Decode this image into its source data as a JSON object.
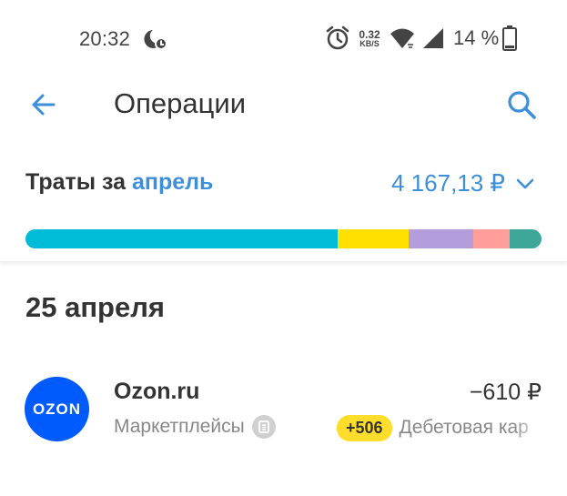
{
  "status_bar": {
    "time": "20:32",
    "net_speed_value": "0.32",
    "net_speed_unit": "KB/S",
    "battery_text": "14 %",
    "icons": [
      "moon-icon",
      "alarm-icon",
      "wifi-icon",
      "signal-icon",
      "battery-icon"
    ]
  },
  "app_bar": {
    "title": "Операции",
    "icons": [
      "back-arrow-icon",
      "search-icon"
    ]
  },
  "summary": {
    "label": "Траты за",
    "month": "апрель",
    "total": "4 167,13 ₽",
    "bar_segments": [
      {
        "color": "#00bcd9",
        "share": 0.605
      },
      {
        "color": "#ffe000",
        "share": 0.138
      },
      {
        "color": "#b39ddb",
        "share": 0.125
      },
      {
        "color": "#ff9e9a",
        "share": 0.071
      },
      {
        "color": "#3fa69a",
        "share": 0.061
      }
    ]
  },
  "date_header": "25 апреля",
  "transactions": [
    {
      "logo_text": "OZON",
      "logo_color": "#005bff",
      "merchant": "Ozon.ru",
      "category": "Маркетплейсы",
      "amount": "−610 ₽",
      "cashback": "+506",
      "account": "Дебетовая кар"
    }
  ],
  "colors": {
    "accent": "#3d8fd9",
    "cashback_badge": "#ffdd2d"
  }
}
